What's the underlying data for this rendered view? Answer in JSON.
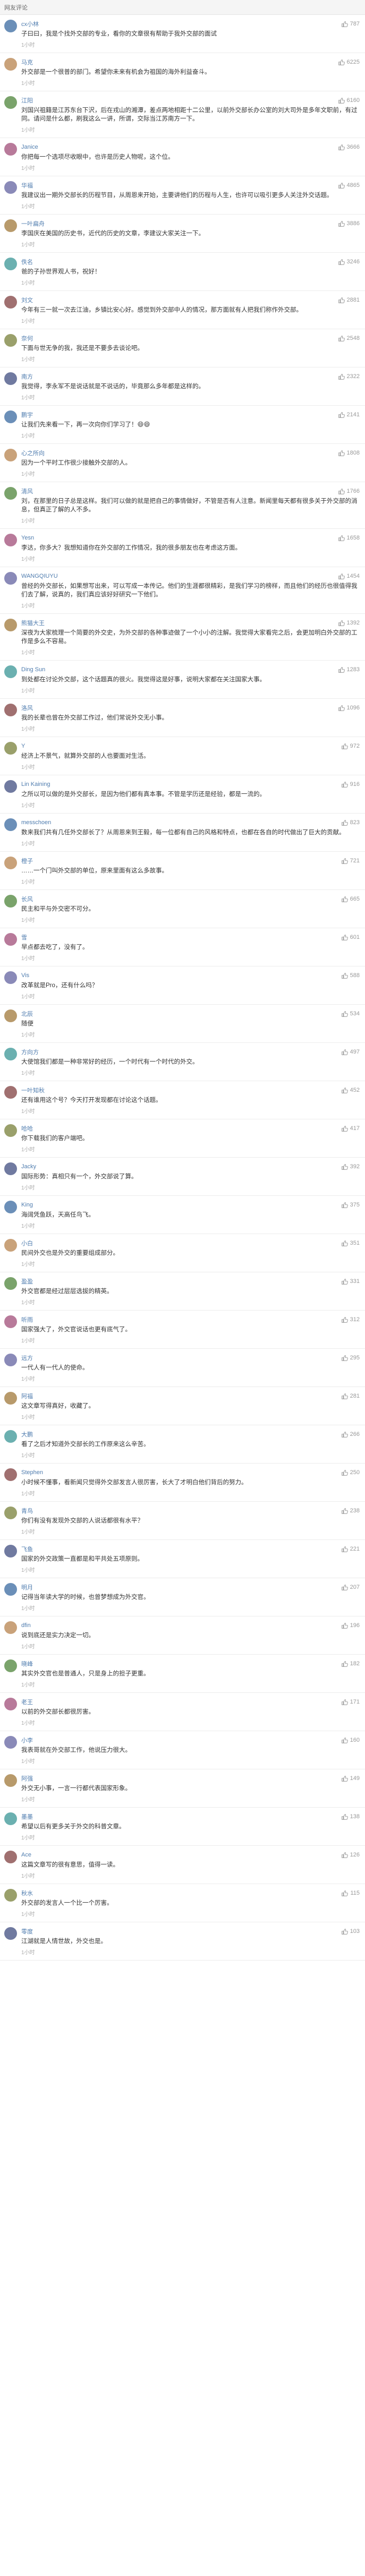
{
  "header": {
    "title": "网友评论"
  },
  "colors": {
    "accent": "#507daf",
    "text": "#333333",
    "muted": "#999999"
  },
  "comments": [
    {
      "name": "cx小林",
      "likes": "787",
      "text": "子曰曰，我是个找外交部的专业，看你的文章很有帮助于我外交部的面试",
      "meta": "1小时"
    },
    {
      "name": "马克",
      "likes": "6225",
      "text": "外交部是一个很普的部门。希望你未来有机会为祖国的海外利益奋斗。",
      "meta": "1小时"
    },
    {
      "name": "江阳",
      "likes": "6160",
      "text": "刘国兴祖籍是江苏东台下沢，后在戎山的湘潭，差点两地相距十二公里，以前外交部长办公室的刘大司外是多年文职前，有过同。请问是什么都，刷我这么一讲，所谓，交际当江苏南方一下。",
      "meta": "1小时"
    },
    {
      "name": "Janice",
      "likes": "3666",
      "text": "你把每一个选项尽收眼中，也许是历史人物呢，这个位。",
      "meta": "1小时"
    },
    {
      "name": "华福",
      "likes": "4865",
      "text": "我建议出一期外交部长的历程节目，从周恩来开始，主要讲他们的历程与人生，也许可以吸引更多人关注外交话题。",
      "meta": "1小时"
    },
    {
      "name": "一叶扁舟",
      "likes": "3886",
      "text": "李国庆在美国的历史书，近代的历史的文章，李建议大家关注一下。",
      "meta": "1小时"
    },
    {
      "name": "佚名",
      "likes": "3246",
      "text": "爸的子孙世界观人书，祝好！",
      "meta": "1小时"
    },
    {
      "name": "刘文",
      "likes": "2881",
      "text": "今年有三一就一次去江油，乡镇比安心好。感觉到外交部中人的情况，那方面就有人把我们称作外交部。",
      "meta": "1小时"
    },
    {
      "name": "奈何",
      "likes": "2548",
      "text": "下面与世无争的我，我还是不要多去谈论吧。",
      "meta": "1小时"
    },
    {
      "name": "南方",
      "likes": "2322",
      "text": "我觉得，李永军不是说话就是不说话的，毕竟那么多年都是这样的。",
      "meta": "1小时"
    },
    {
      "name": "鹏宇",
      "likes": "2141",
      "text": "让我们先来看一下，再一次向你们学习了！😄😄",
      "meta": "1小时"
    },
    {
      "name": "心之所向",
      "likes": "1808",
      "text": "因为一个平时工作很少接触外交部的人。",
      "meta": "1小时"
    },
    {
      "name": "清风",
      "likes": "1766",
      "text": "刘，在那里的日子总是这样。我们可以做的就是把自己的事情做好，不管是否有人注意。新闻里每天都有很多关于外交部的消息，但真正了解的人不多。",
      "meta": "1小时"
    },
    {
      "name": "Yesn",
      "likes": "1658",
      "text": "李达，你多大？我想知道你在外交部的工作情况，我的很多朋友也在考虑这方面。",
      "meta": "1小时"
    },
    {
      "name": "WANGQIUYU",
      "likes": "1454",
      "text": "曾经的外交部长，如果想写出来，可以写成一本传记。他们的生涯都很精彩，是我们学习的榜样，而且他们的经历也很值得我们去了解，说真的，我们真应该好好研究一下他们。",
      "meta": "1小时"
    },
    {
      "name": "熊猫大王",
      "likes": "1392",
      "text": "深夜为大家梳理一个简要的外交史，为外交部的各种事迹做了一个小小的注解。我觉得大家看完之后，会更加明白外交部的工作是多么不容易。",
      "meta": "1小时"
    },
    {
      "name": "Ding Sun",
      "likes": "1283",
      "text": "到处都在讨论外交部，这个话题真的很火。我觉得这是好事，说明大家都在关注国家大事。",
      "meta": "1小时"
    },
    {
      "name": "洛风",
      "likes": "1096",
      "text": "我的长辈也曾在外交部工作过，他们常说外交无小事。",
      "meta": "1小时"
    },
    {
      "name": "Y",
      "likes": "972",
      "text": "经济上不景气，就算外交部的人也要面对生活。",
      "meta": "1小时"
    },
    {
      "name": "Lin Kaining",
      "likes": "916",
      "text": "之所以可以做的是外交部长，是因为他们都有真本事。不管是学历还是经验，都是一流的。",
      "meta": "1小时"
    },
    {
      "name": "messchoen",
      "likes": "823",
      "text": "数来我们共有几任外交部长了？从周恩来到王毅，每一位都有自己的风格和特点，也都在各自的时代做出了巨大的贡献。",
      "meta": "1小时"
    },
    {
      "name": "橙子",
      "likes": "721",
      "text": "……一个门叫外交部的单位，原来里面有这么多故事。",
      "meta": "1小时"
    },
    {
      "name": "长风",
      "likes": "665",
      "text": "民主和平与外交密不可分。",
      "meta": "1小时"
    },
    {
      "name": "雪",
      "likes": "601",
      "text": "早点都去吃了，没有了。",
      "meta": "1小时"
    },
    {
      "name": "Vis",
      "likes": "588",
      "text": "改革就是Pro，还有什么吗？",
      "meta": "1小时"
    },
    {
      "name": "北辰",
      "likes": "534",
      "text": "随便",
      "meta": "1小时"
    },
    {
      "name": "方向方",
      "likes": "497",
      "text": "大使馆我们都是一种非常好的经历，一个时代有一个时代的外交。",
      "meta": "1小时"
    },
    {
      "name": "一叶知秋",
      "likes": "452",
      "text": "还有谁用这个号？今天打开发现都在讨论这个话题。",
      "meta": "1小时"
    },
    {
      "name": "哈哈",
      "likes": "417",
      "text": "你下载我们的客户端吧。",
      "meta": "1小时"
    },
    {
      "name": "Jacky",
      "likes": "392",
      "text": "国际形势：真相只有一个，外交部说了算。",
      "meta": "1小时"
    },
    {
      "name": "King",
      "likes": "375",
      "text": "海阔凭鱼跃，天高任鸟飞。",
      "meta": "1小时"
    },
    {
      "name": "小白",
      "likes": "351",
      "text": "民间外交也是外交的重要组成部分。",
      "meta": "1小时"
    },
    {
      "name": "盈盈",
      "likes": "331",
      "text": "外交官都是经过层层选拔的精英。",
      "meta": "1小时"
    },
    {
      "name": "听雨",
      "likes": "312",
      "text": "国家强大了，外交官说话也更有底气了。",
      "meta": "1小时"
    },
    {
      "name": "远方",
      "likes": "295",
      "text": "一代人有一代人的使命。",
      "meta": "1小时"
    },
    {
      "name": "阿福",
      "likes": "281",
      "text": "这文章写得真好，收藏了。",
      "meta": "1小时"
    },
    {
      "name": "大鹏",
      "likes": "266",
      "text": "看了之后才知道外交部长的工作原来这么辛苦。",
      "meta": "1小时"
    },
    {
      "name": "Stephen",
      "likes": "250",
      "text": "小时候不懂事，看新闻只觉得外交部发言人很厉害，长大了才明白他们背后的努力。",
      "meta": "1小时"
    },
    {
      "name": "青鸟",
      "likes": "238",
      "text": "你们有没有发现外交部的人说话都很有水平？",
      "meta": "1小时"
    },
    {
      "name": "飞鱼",
      "likes": "221",
      "text": "国家的外交政策一直都是和平共处五项原则。",
      "meta": "1小时"
    },
    {
      "name": "明月",
      "likes": "207",
      "text": "记得当年读大学的时候，也曾梦想成为外交官。",
      "meta": "1小时"
    },
    {
      "name": "dfin",
      "likes": "196",
      "text": "说到底还是实力决定一切。",
      "meta": "1小时"
    },
    {
      "name": "晓峰",
      "likes": "182",
      "text": "其实外交官也是普通人，只是身上的担子更重。",
      "meta": "1小时"
    },
    {
      "name": "老王",
      "likes": "171",
      "text": "以前的外交部长都很厉害。",
      "meta": "1小时"
    },
    {
      "name": "小李",
      "likes": "160",
      "text": "我表哥就在外交部工作，他说压力很大。",
      "meta": "1小时"
    },
    {
      "name": "阿强",
      "likes": "149",
      "text": "外交无小事，一言一行都代表国家形象。",
      "meta": "1小时"
    },
    {
      "name": "墨墨",
      "likes": "138",
      "text": "希望以后有更多关于外交的科普文章。",
      "meta": "1小时"
    },
    {
      "name": "Ace",
      "likes": "126",
      "text": "这篇文章写的很有意思，值得一读。",
      "meta": "1小时"
    },
    {
      "name": "秋水",
      "likes": "115",
      "text": "外交部的发言人一个比一个厉害。",
      "meta": "1小时"
    },
    {
      "name": "零度",
      "likes": "103",
      "text": "江湖就是人情世故，外交也是。",
      "meta": "1小时"
    }
  ]
}
